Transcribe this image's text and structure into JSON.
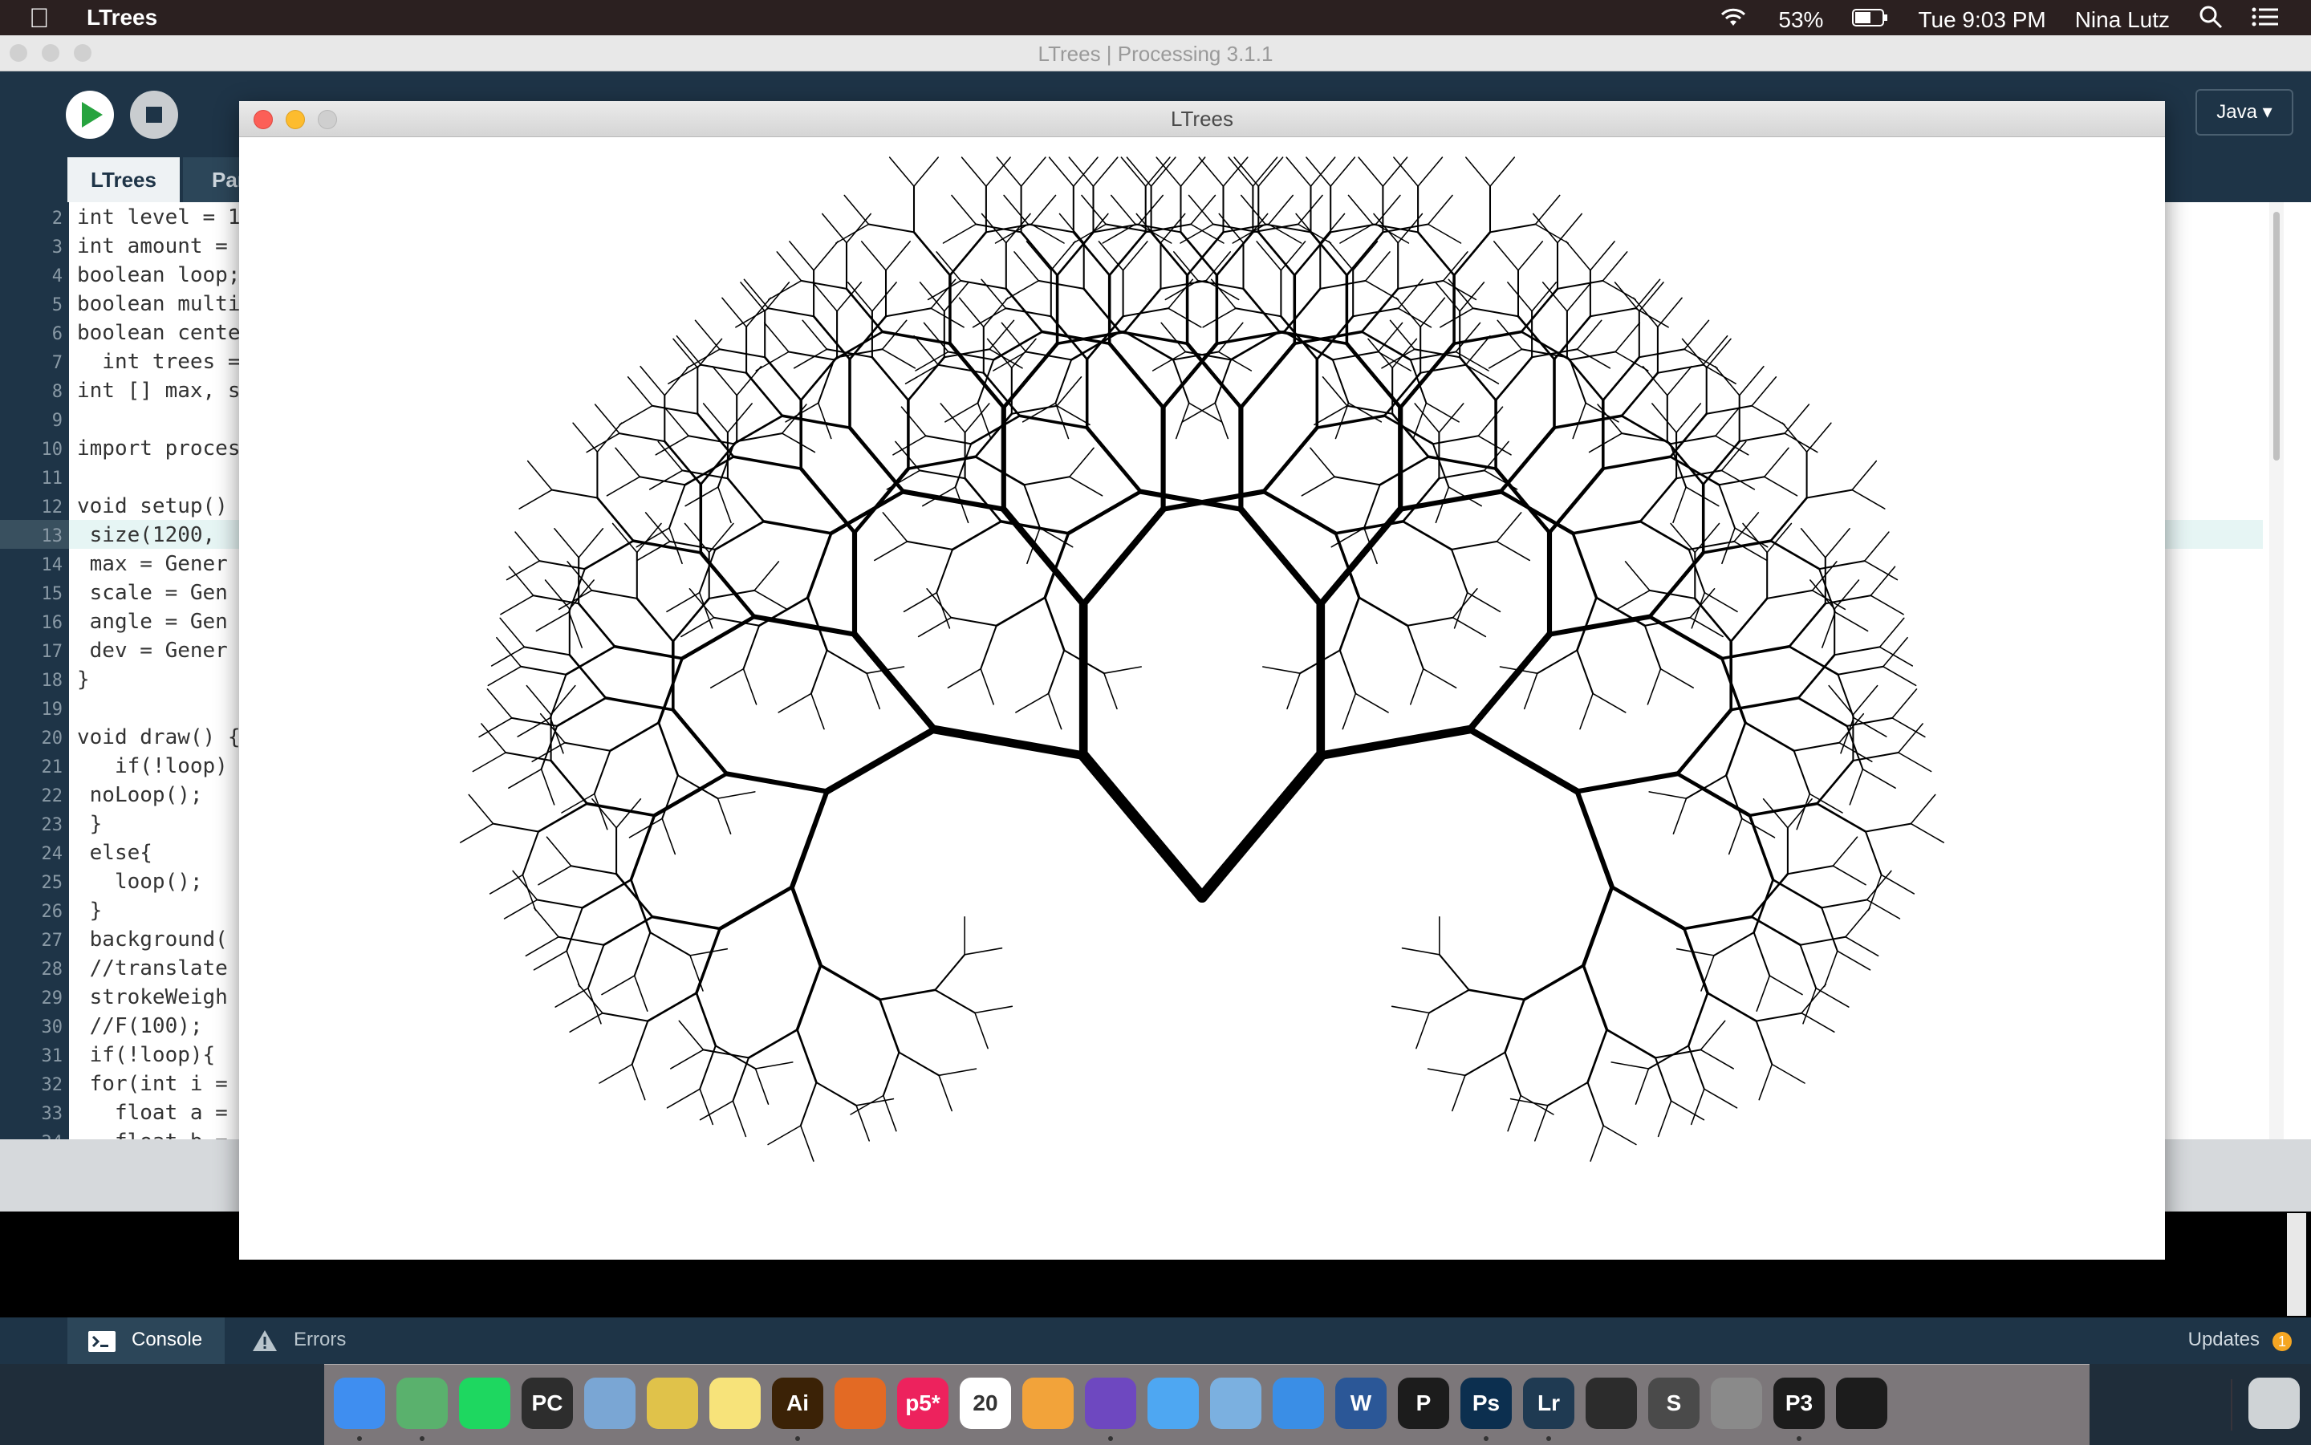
{
  "menubar": {
    "app_name": "LTrees",
    "battery": "53%",
    "clock": "Tue 9:03 PM",
    "user": "Nina Lutz"
  },
  "ide": {
    "window_title": "LTrees | Processing 3.1.1",
    "mode": "Java",
    "tabs": [
      "LTrees",
      "Par"
    ],
    "code_lines": [
      {
        "n": "2",
        "t": "int level = 1"
      },
      {
        "n": "3",
        "t": "int amount = "
      },
      {
        "n": "4",
        "t": "boolean loop;"
      },
      {
        "n": "5",
        "t": "boolean multi"
      },
      {
        "n": "6",
        "t": "boolean cente"
      },
      {
        "n": "7",
        "t": "  int trees ="
      },
      {
        "n": "8",
        "t": "int [] max, s"
      },
      {
        "n": "9",
        "t": ""
      },
      {
        "n": "10",
        "t": "import proces"
      },
      {
        "n": "11",
        "t": ""
      },
      {
        "n": "12",
        "t": "void setup()"
      },
      {
        "n": "13",
        "t": " size(1200,"
      },
      {
        "n": "14",
        "t": " max = Gener"
      },
      {
        "n": "15",
        "t": " scale = Gen"
      },
      {
        "n": "16",
        "t": " angle = Gen"
      },
      {
        "n": "17",
        "t": " dev = Gener"
      },
      {
        "n": "18",
        "t": "}"
      },
      {
        "n": "19",
        "t": ""
      },
      {
        "n": "20",
        "t": "void draw() {"
      },
      {
        "n": "21",
        "t": "   if(!loop)"
      },
      {
        "n": "22",
        "t": " noLoop();"
      },
      {
        "n": "23",
        "t": " }"
      },
      {
        "n": "24",
        "t": " else{"
      },
      {
        "n": "25",
        "t": "   loop();"
      },
      {
        "n": "26",
        "t": " }"
      },
      {
        "n": "27",
        "t": " background("
      },
      {
        "n": "28",
        "t": " //translate"
      },
      {
        "n": "29",
        "t": " strokeWeigh"
      },
      {
        "n": "30",
        "t": " //F(100);"
      },
      {
        "n": "31",
        "t": " if(!loop){"
      },
      {
        "n": "32",
        "t": " for(int i ="
      },
      {
        "n": "33",
        "t": "   float a ="
      },
      {
        "n": "34",
        "t": "   float b ="
      }
    ],
    "console_tab": "Console",
    "errors_tab": "Errors",
    "updates_label": "Updates",
    "updates_count": "1"
  },
  "sketch": {
    "title": "LTrees",
    "tree": {
      "trunk_length": 230,
      "angle_deg": 40,
      "length_ratio": 0.82,
      "depth": 9,
      "stroke_root": 14,
      "stroke_ratio": 0.76
    }
  },
  "dock": {
    "apps": [
      {
        "name": "finder-icon",
        "label": "",
        "color": "#3f8ef0"
      },
      {
        "name": "atom-icon",
        "label": "",
        "color": "#5ab16d"
      },
      {
        "name": "spotify-icon",
        "label": "",
        "color": "#1ed760"
      },
      {
        "name": "pycharm-icon",
        "label": "PC",
        "color": "#2d2d2d"
      },
      {
        "name": "preview-icon",
        "label": "",
        "color": "#7aa6d4"
      },
      {
        "name": "python-icon",
        "label": "",
        "color": "#e0c24a"
      },
      {
        "name": "notes-icon",
        "label": "",
        "color": "#f7e37a"
      },
      {
        "name": "illustrator-icon",
        "label": "Ai",
        "color": "#3b2206"
      },
      {
        "name": "matlab-icon",
        "label": "",
        "color": "#e36a24"
      },
      {
        "name": "p5-icon",
        "label": "p5*",
        "color": "#ed225d"
      },
      {
        "name": "calendar-icon",
        "label": "20",
        "color": "#ffffff"
      },
      {
        "name": "photos-icon",
        "label": "",
        "color": "#f2a33a"
      },
      {
        "name": "github-icon",
        "label": "",
        "color": "#6e48c0"
      },
      {
        "name": "messages-icon",
        "label": "",
        "color": "#4ea7f2"
      },
      {
        "name": "mail-icon",
        "label": "",
        "color": "#7bb0e0"
      },
      {
        "name": "safari-icon",
        "label": "",
        "color": "#3a8ee6"
      },
      {
        "name": "word-icon",
        "label": "W",
        "color": "#2b5797"
      },
      {
        "name": "processing-icon",
        "label": "P",
        "color": "#1c1c1c"
      },
      {
        "name": "photoshop-icon",
        "label": "Ps",
        "color": "#0c2f4f"
      },
      {
        "name": "lightroom-icon",
        "label": "Lr",
        "color": "#1f3a52"
      },
      {
        "name": "activity-monitor-icon",
        "label": "",
        "color": "#2c2c2c"
      },
      {
        "name": "sublime-icon",
        "label": "S",
        "color": "#4a4a4a"
      },
      {
        "name": "system-preferences-icon",
        "label": "",
        "color": "#8a8a8a"
      },
      {
        "name": "processing3-icon",
        "label": "P3",
        "color": "#1c1c1c"
      },
      {
        "name": "quicktime-icon",
        "label": "",
        "color": "#1c1c1c"
      }
    ],
    "trash": {
      "name": "trash-icon"
    }
  }
}
